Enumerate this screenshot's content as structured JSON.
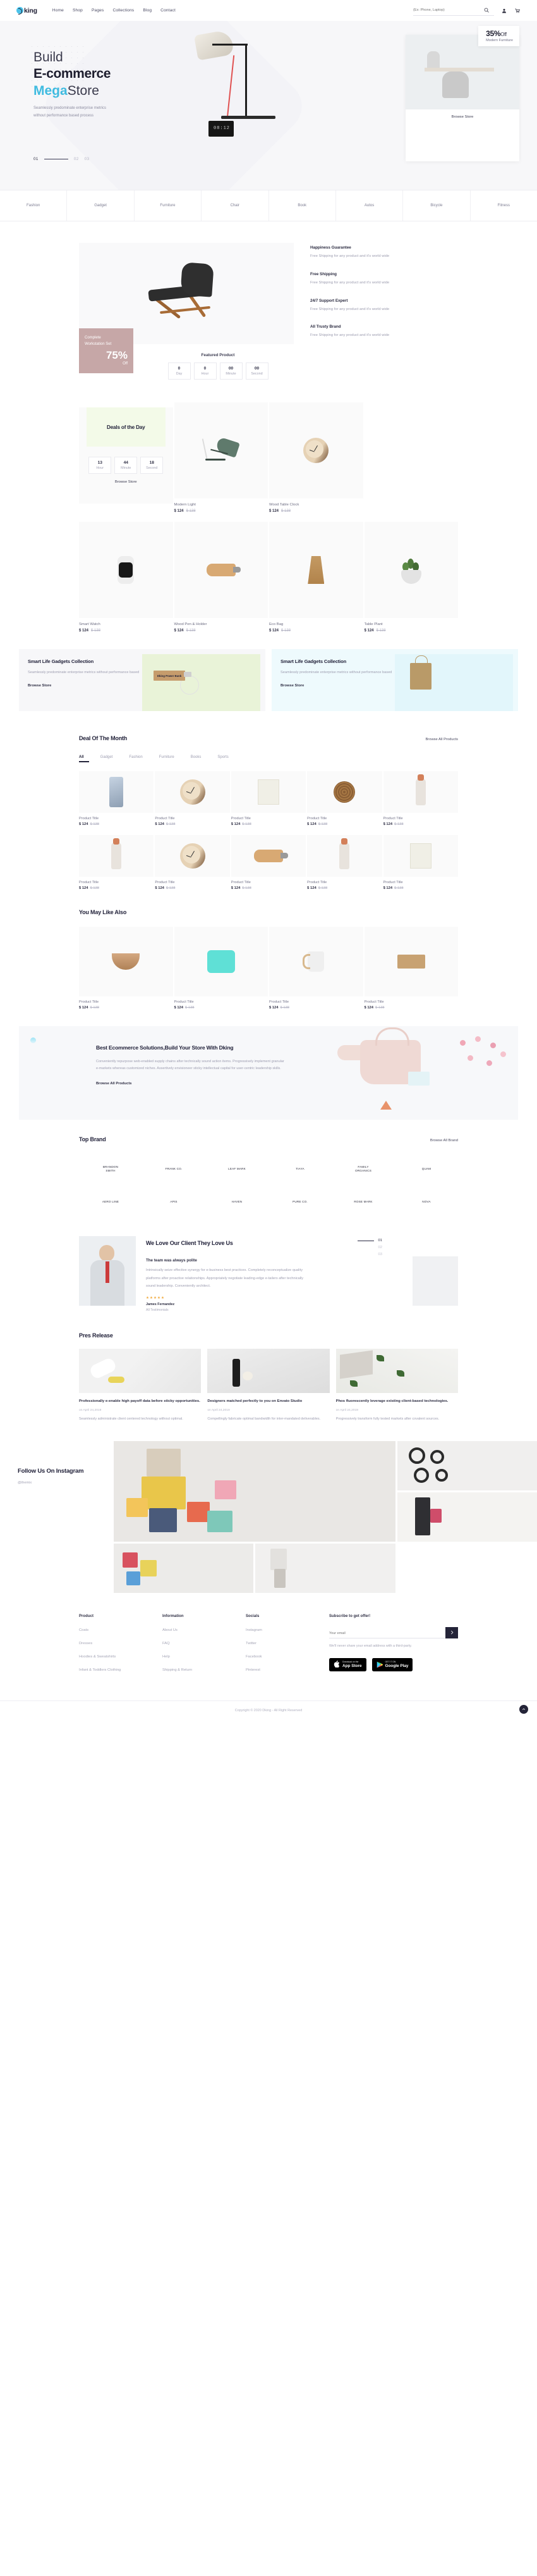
{
  "header": {
    "logo_text": "king",
    "nav": [
      "Home",
      "Shop",
      "Pages",
      "Collections",
      "Blog",
      "Contact"
    ],
    "search_placeholder": "(Ex: Phone, Laptop)",
    "icons": {
      "search": "search-icon",
      "account": "user-icon",
      "cart": "cart-icon"
    }
  },
  "hero": {
    "line1": "Build",
    "line2": "E-commerce",
    "line3_accent": "Mega",
    "line3_rest": "Store",
    "sub1": "Seamlessly predominate enterprise metrics",
    "sub2": "without performance based process",
    "pager": [
      "01",
      "02",
      "03"
    ],
    "card": {
      "discount": "35%",
      "discount_suffix": "Off",
      "label": "Modern Furniture",
      "cta": "Browse Store"
    },
    "clock_digits": "08:12"
  },
  "categories": [
    "Fashion",
    "Gadget",
    "Furniture",
    "Chair",
    "Book",
    "Autos",
    "Bicycle",
    "Fitness"
  ],
  "featured": {
    "promo_title_line1": "Complete",
    "promo_title_line2": "Workstation Set",
    "promo_percent": "75%",
    "promo_off": "Off",
    "label": "Featured Product",
    "countdown": [
      {
        "n": "0",
        "u": "Day"
      },
      {
        "n": "0",
        "u": "Hour"
      },
      {
        "n": "00",
        "u": "Minute"
      },
      {
        "n": "00",
        "u": "Second"
      }
    ],
    "services": [
      {
        "title": "Happiness Guarantee",
        "text": "Free Shipping for any product and it's world wide"
      },
      {
        "title": "Free Shipping",
        "text": "Free Shipping for any product and it's world wide"
      },
      {
        "title": "24/7 Support Expert",
        "text": "Free Shipping for any product and it's world wide"
      },
      {
        "title": "All Trusty Brand",
        "text": "Free Shipping for any product and it's world wide"
      }
    ]
  },
  "deals": {
    "title": "Deals of the Day",
    "countdown": [
      {
        "n": "13",
        "u": "Hour"
      },
      {
        "n": "44",
        "u": "Minute"
      },
      {
        "n": "18",
        "u": "Second"
      }
    ],
    "browse": "Browse Store",
    "products": [
      {
        "name": "Modern Light",
        "price": "$ 124",
        "old": "$ 138",
        "art": "lamp"
      },
      {
        "name": "Wood Table Clock",
        "price": "$ 124",
        "old": "$ 138",
        "art": "clock"
      },
      {
        "name": "Smart Watch",
        "price": "$ 124",
        "old": "$ 138",
        "art": "watch"
      },
      {
        "name": "Wood Pen & Holder",
        "price": "$ 124",
        "old": "$ 138",
        "art": "pen"
      },
      {
        "name": "Eco Bag",
        "price": "$ 124",
        "old": "$ 138",
        "art": "bag"
      },
      {
        "name": "Table Plant",
        "price": "$ 124",
        "old": "$ 138",
        "art": "plant"
      }
    ]
  },
  "banners": [
    {
      "title": "Smart Life Gadgets Collection",
      "text": "Seamlessly predominate enterprise metrics without performance based",
      "cta": "Browse Store",
      "product_label": "Dking Power Bank"
    },
    {
      "title": "Smart Life Gadgets Collection",
      "text": "Seamlessly predominate enterprise metrics without performance based",
      "cta": "Browse Store",
      "product_label": ""
    }
  ],
  "deal_month": {
    "title": "Deal Of The Month",
    "more": "Browse All Products",
    "tabs": [
      "All",
      "Gadget",
      "Fashion",
      "Furniture",
      "Books",
      "Sports"
    ],
    "active_tab": "All",
    "products": [
      {
        "title": "Product Title",
        "price": "$ 124",
        "old": "$ 138",
        "art": "phone"
      },
      {
        "title": "Product Title",
        "price": "$ 124",
        "old": "$ 138",
        "art": "clock"
      },
      {
        "title": "Product Title",
        "price": "$ 124",
        "old": "$ 138",
        "art": "frame"
      },
      {
        "title": "Product Title",
        "price": "$ 124",
        "old": "$ 138",
        "art": "tape"
      },
      {
        "title": "Product Title",
        "price": "$ 124",
        "old": "$ 138",
        "art": "bottle"
      },
      {
        "title": "Product Title",
        "price": "$ 124",
        "old": "$ 138",
        "art": "bottle"
      },
      {
        "title": "Product Title",
        "price": "$ 124",
        "old": "$ 138",
        "art": "clock"
      },
      {
        "title": "Product Title",
        "price": "$ 124",
        "old": "$ 138",
        "art": "pen"
      },
      {
        "title": "Product Title",
        "price": "$ 124",
        "old": "$ 138",
        "art": "bottle"
      },
      {
        "title": "Product Title",
        "price": "$ 124",
        "old": "$ 138",
        "art": "frame"
      }
    ]
  },
  "you_may_like": {
    "title": "You May Like Also",
    "products": [
      {
        "title": "Product Title",
        "price": "$ 124",
        "old": "$ 138",
        "art": "bowl"
      },
      {
        "title": "Product Title",
        "price": "$ 124",
        "old": "$ 138",
        "art": "shirt"
      },
      {
        "title": "Product Title",
        "price": "$ 124",
        "old": "$ 138",
        "art": "mug"
      },
      {
        "title": "Product Title",
        "price": "$ 124",
        "old": "$ 138",
        "art": "box"
      }
    ]
  },
  "promo_wide": {
    "title": "Best Ecommerce Solutions,Build Your Store With Dking",
    "text": "Conveniently repurpose web-enabled supply chains after technically sound action items. Progressively implement granular e-markets whereas customized niches. Assertively envisioneer sticky intellectual capital for user-centric leadership skills.",
    "cta": "Browse All Products"
  },
  "brands": {
    "title": "Top Brand",
    "more": "Browse All Brand",
    "items": [
      "BRANDON SMITH",
      "FRANK CO.",
      "LEAF MARK",
      "TIAYA",
      "FAMILY ORGANICS",
      "QUAM",
      "AERO LINE",
      "APIS",
      "HAVEN",
      "PURE CO.",
      "ROSE MARK",
      "NOVA"
    ]
  },
  "testimonial": {
    "title": "We Love Our Client They Love Us",
    "subtitle": "The team was always polite",
    "text": "Intrinsically seize effective synergy for e-business best practices. Completely reconceptualize quality platforms after proactive relationships. Appropriately negotiate leading-edge e-tailers after technically sound leadership. Conveniently architect.",
    "stars": "★★★★★",
    "name": "James Fernandez",
    "role": "All Testimonials",
    "pager": [
      "01",
      "02",
      "03"
    ]
  },
  "press": {
    "title": "Pres Release",
    "items": [
      {
        "title": "Professionally e-enable high payoff data before sticky opportunities.",
        "date": "on April 24,2019",
        "text": "Seamlessly administrate client centered technology without optimal."
      },
      {
        "title": "Designers matched perfectly to you on Envato Studio",
        "date": "on April 24,2019",
        "text": "Compellingly fabricate optimal bandwidth for inter-mandated deliverables."
      },
      {
        "title": "Phos fluorescently leverage existing client-based technologies.",
        "date": "on April 24,2019",
        "text": "Progressively transform fully tested markets after covalent sources."
      }
    ]
  },
  "instagram": {
    "title": "Follow Us On Instagram",
    "handle": "@themix"
  },
  "footer": {
    "columns": [
      {
        "heading": "Product",
        "links": [
          "Coats",
          "Dresses",
          "Hoodies & Sweatshirts",
          "Infant & Toddlers Clothing"
        ]
      },
      {
        "heading": "Information",
        "links": [
          "About Us",
          "FAQ",
          "Help",
          "Shipping & Return"
        ]
      },
      {
        "heading": "Socials",
        "links": [
          "Instagram",
          "Twitter",
          "Facebook",
          "Pinterest"
        ]
      }
    ],
    "subscribe": {
      "heading": "Subscribe to get offer!",
      "placeholder": "Your email",
      "submit_icon": "chevron-right-icon",
      "note": "We'll never share your email address with a third-party.",
      "apple": {
        "small": "Download on the",
        "big": "App Store"
      },
      "google": {
        "small": "GET IT ON",
        "big": "Google Play"
      }
    },
    "copyright": "Copyright © 2020 Dking - All Right Reserved",
    "to_top_icon": "chevron-up-icon"
  }
}
